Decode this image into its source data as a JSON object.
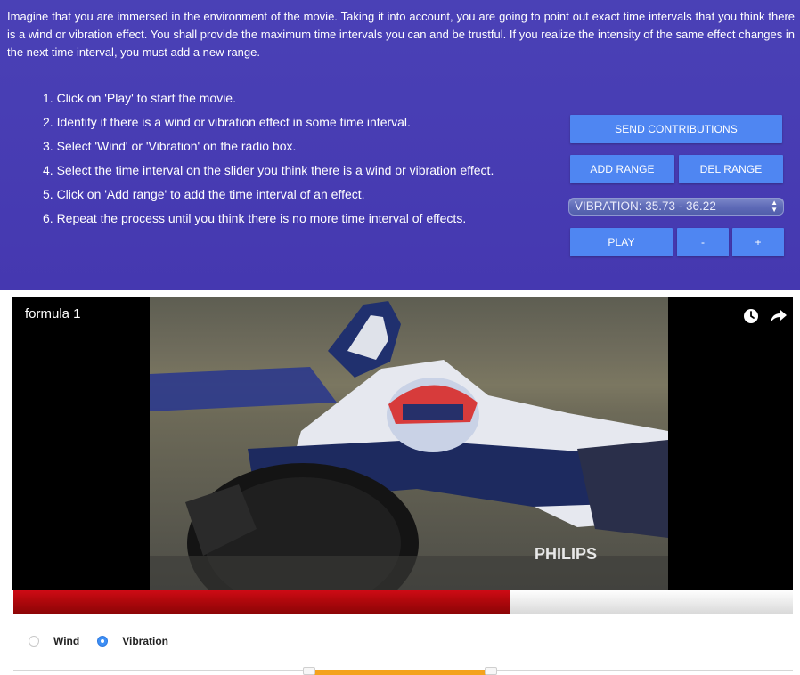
{
  "instructions": {
    "intro": "Imagine that you are immersed in the environment of the movie. Taking it into account, you are going to point out exact time intervals that you think there is a wind or vibration effect. You shall provide the maximum time intervals you can and be trustful. If you realize the intensity of the same effect changes in the next time interval, you must add a new range.",
    "steps": [
      "1. Click on 'Play' to start the movie.",
      "2. Identify if there is a wind or vibration effect in some time interval.",
      "3. Select 'Wind' or 'Vibration' on the radio box.",
      "4. Select the time interval on the slider you think there is a wind or vibration effect.",
      "5. Click on 'Add range' to add the time interval of an effect.",
      "6. Repeat the process until you think there is no more time interval of effects."
    ]
  },
  "controls": {
    "send_label": "SEND CONTRIBUTIONS",
    "add_range_label": "ADD RANGE",
    "del_range_label": "DEL RANGE",
    "range_select_value": "VIBRATION: 35.73 - 36.22",
    "play_label": "PLAY",
    "minus_label": "-",
    "plus_label": "+"
  },
  "video": {
    "title": "formula 1",
    "icons": [
      "clock-icon",
      "share-icon"
    ],
    "watermark": "PHILIPS"
  },
  "progress": {
    "fraction": 0.638,
    "color": "#c0090f"
  },
  "effect_type": {
    "options": [
      "Wind",
      "Vibration"
    ],
    "selected": "Vibration"
  },
  "range_slider": {
    "start_fraction": 0.379,
    "end_fraction": 0.612,
    "color": "#f4a21c"
  },
  "colors": {
    "panel": "#4538b0",
    "button": "#4f86f2"
  }
}
